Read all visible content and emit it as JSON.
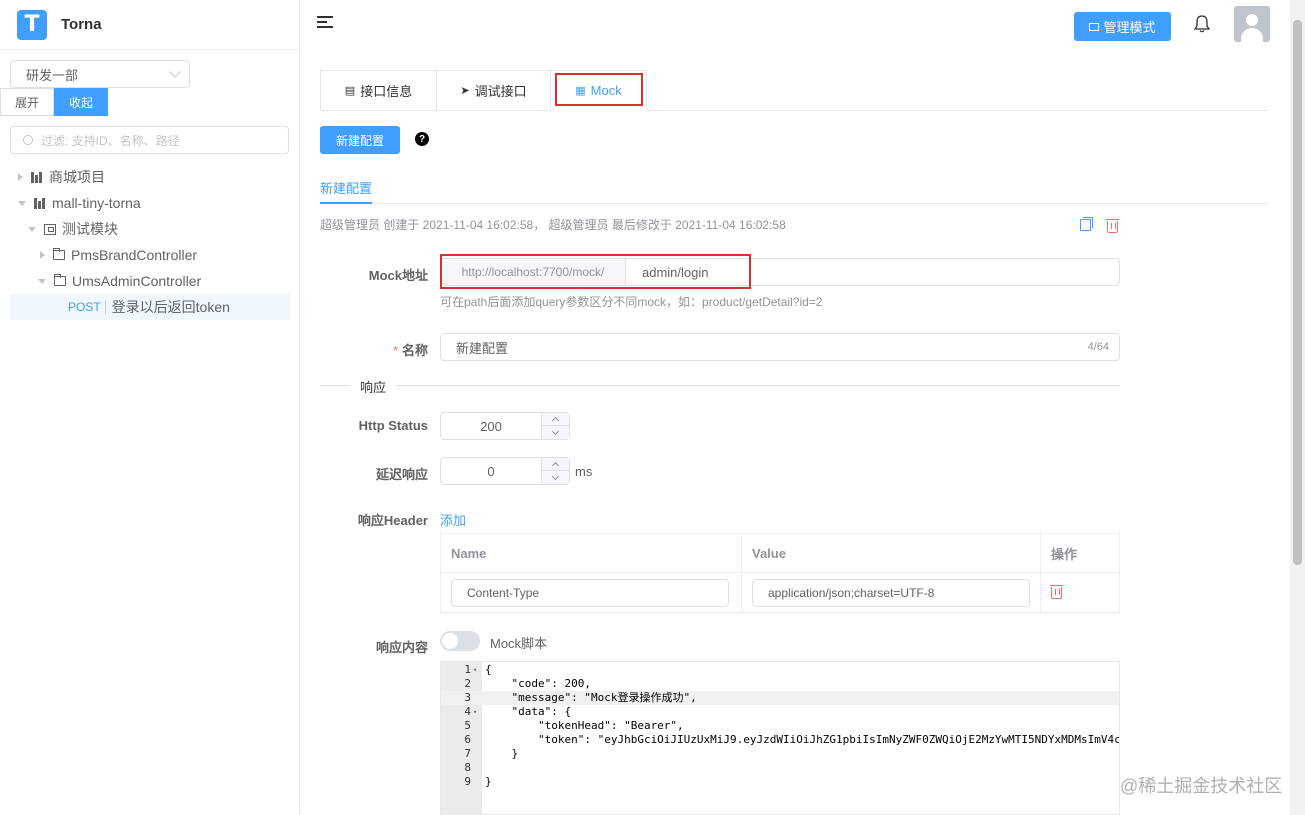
{
  "app": {
    "logo_letter": "T",
    "name": "Torna"
  },
  "sidebar": {
    "space": "研发一部",
    "expand_label": "展开",
    "collapse_label": "收起",
    "filter_placeholder": "过滤: 支持ID、名称、路径",
    "tree": [
      {
        "label": "商城项目"
      },
      {
        "label": "mall-tiny-torna"
      },
      {
        "label": "测试模块"
      },
      {
        "label": "PmsBrandController"
      },
      {
        "label": "UmsAdminController"
      },
      {
        "method": "POST",
        "label": "登录以后返回token"
      }
    ]
  },
  "header": {
    "admin_mode": "管理模式"
  },
  "tabs": [
    {
      "label": "接口信息"
    },
    {
      "label": "调试接口"
    },
    {
      "label": "Mock"
    }
  ],
  "toolbar": {
    "new_config": "新建配置"
  },
  "sub_tab": "新建配置",
  "meta": "超级管理员 创建于 2021-11-04 16:02:58， 超级管理员 最后修改于 2021-11-04 16:02:58",
  "form": {
    "mock_url_label": "Mock地址",
    "mock_prefix": "http://localhost:7700/mock/",
    "mock_path": "admin/login",
    "mock_hint": "可在path后面添加query参数区分不同mock，如：product/getDetail?id=2",
    "name_label": "名称",
    "name_value": "新建配置",
    "name_count": "4/64",
    "section_response": "响应",
    "http_status_label": "Http Status",
    "http_status": "200",
    "delay_label": "延迟响应",
    "delay": "0",
    "delay_unit": "ms",
    "header_label": "响应Header",
    "add_label": "添加",
    "table_headers": [
      "Name",
      "Value",
      "操作"
    ],
    "rows": [
      {
        "name": "Content-Type",
        "value": "application/json;charset=UTF-8"
      }
    ],
    "content_label": "响应内容",
    "mock_script_label": "Mock脚本"
  },
  "editor_lines": [
    {
      "no": "1",
      "fold": "▾",
      "text": "{"
    },
    {
      "no": "2",
      "text": "    \"code\": 200,"
    },
    {
      "no": "3",
      "text": "    \"message\": \"Mock登录操作成功\","
    },
    {
      "no": "4",
      "fold": "▾",
      "text": "    \"data\": {"
    },
    {
      "no": "5",
      "text": "        \"tokenHead\": \"Bearer\","
    },
    {
      "no": "6",
      "text": "        \"token\": \"eyJhbGciOiJIUzUxMiJ9.eyJzdWIiOiJhZG1pbiIsImNyZWF0ZWQiOjE2MzYwMTI5NDYxMDMsImV4c"
    },
    {
      "no": "7",
      "text": "    }"
    },
    {
      "no": "8",
      "text": ""
    },
    {
      "no": "9",
      "text": "}"
    }
  ],
  "watermark": "@稀土掘金技术社区"
}
